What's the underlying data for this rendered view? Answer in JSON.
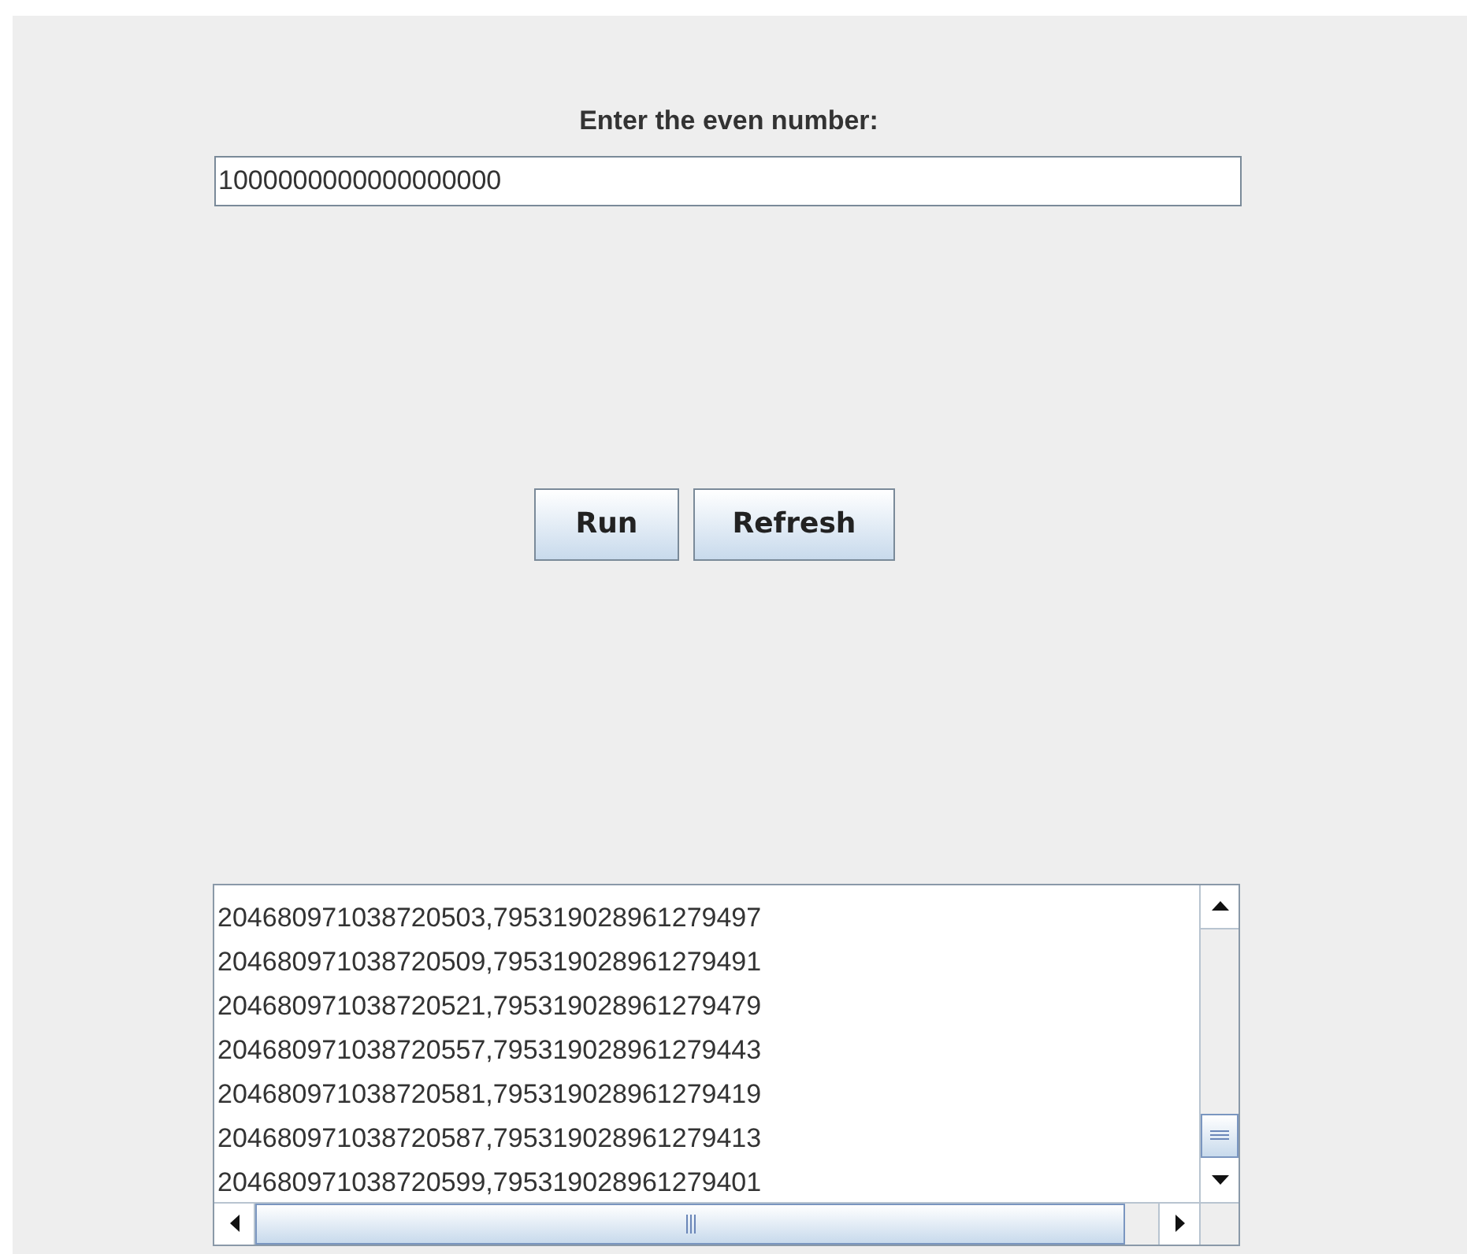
{
  "prompt_label": "Enter the even number:",
  "number_field": {
    "value": "1000000000000000000"
  },
  "buttons": [
    "Run",
    "Refresh"
  ],
  "output_lines": [
    "204680971038720503,795319028961279497",
    "204680971038720509,795319028961279491",
    "204680971038720521,795319028961279479",
    "204680971038720557,795319028961279443",
    "204680971038720581,795319028961279419",
    "204680971038720587,795319028961279413",
    "204680971038720599,795319028961279401"
  ]
}
